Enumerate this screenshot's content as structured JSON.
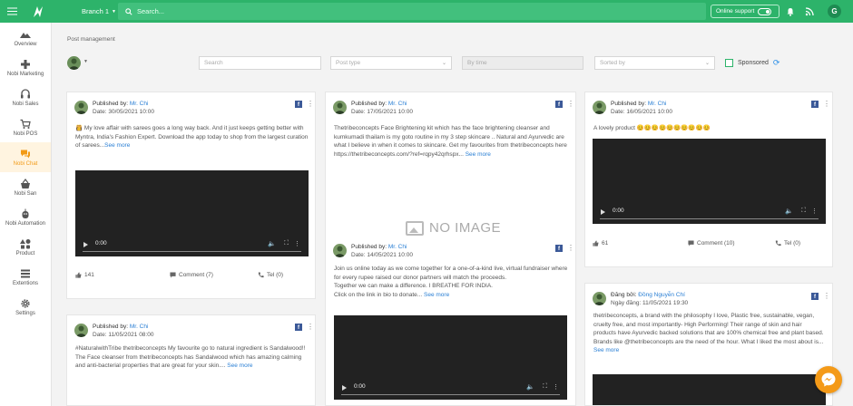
{
  "topbar": {
    "branch": "Branch 1",
    "search_placeholder": "Search...",
    "online_support": "Online support",
    "user_initial": "G"
  },
  "sidebar": {
    "items": [
      {
        "label": "Overview",
        "icon": "mountain-icon"
      },
      {
        "label": "Nobi Marketing",
        "icon": "gamepad-icon"
      },
      {
        "label": "Nobi Sales",
        "icon": "headset-icon"
      },
      {
        "label": "Nobi POS",
        "icon": "cart-icon"
      },
      {
        "label": "Nobi Chat",
        "icon": "chat-icon"
      },
      {
        "label": "Nobi San",
        "icon": "basket-icon"
      },
      {
        "label": "Nobi Automation",
        "icon": "robot-icon"
      },
      {
        "label": "Product",
        "icon": "shapes-icon"
      },
      {
        "label": "Extentions",
        "icon": "list-icon"
      },
      {
        "label": "Settings",
        "icon": "gear-icon"
      }
    ],
    "active_index": 4
  },
  "page": {
    "breadcrumb": "Post management"
  },
  "filters": {
    "search_placeholder": "Search",
    "post_type_placeholder": "Post type",
    "by_time_placeholder": "By time",
    "sorted_by_placeholder": "Sorted by",
    "sponsored_label": "Sponsored"
  },
  "posts": {
    "p1": {
      "published_label": "Published by:",
      "author": "Mr. Chi",
      "date": "Date: 30/05/2021  10:00",
      "text": "👸 My love affair with sarees goes a long way back. And it just keeps getting better with Myntra, India's Fashion Expert. Download the app today to shop from the largest curation of sarees...",
      "more": "See more",
      "video_time": "0:00",
      "likes": "141",
      "comments": "Comment (7)",
      "tel": "Tel (0)"
    },
    "p2": {
      "published_label": "Published by:",
      "author": "Mr. Chi",
      "date": "Date: 17/05/2021  10:00",
      "text": "Thetribeconcepts  Face Brightening kit which has the face brightening cleanser and kumkumadi thailam is my goto routine in my 3 step skincare .. Natural and Ayurvedic are what I believe in when it comes to skincare. Get my favourites from thetribeconcepts  here https://thetribeconcepts.com/?ref=rqpy42qrhspx...",
      "more": "See more",
      "no_image": "NO IMAGE"
    },
    "p3": {
      "published_label": "Published by:",
      "author": "Mr. Chi",
      "date": "Date: 16/05/2021  10:00",
      "text": "A lovely product 😊😊😊😊😊😊😊😊😊😊",
      "video_time": "0:00",
      "likes": "61",
      "comments": "Comment (10)",
      "tel": "Tel (0)"
    },
    "p4": {
      "published_label": "Published by:",
      "author": "Mr. Chi",
      "date": "Date: 11/05/2021  08:00",
      "text": "#NaturalwithTribe thetribeconcepts My favourite go to natural ingredient is Sandalwood!! The Face cleanser from thetribeconcepts has Sandalwood which has amazing calming and anti-bacterial properties that are great for your skin....",
      "more": "See more"
    },
    "p5": {
      "published_label": "Published by:",
      "author": "Mr. Chi",
      "date": "Date: 14/05/2021  10:00",
      "text1": "Join us online today as we come together for a one-of-a-kind live, virtual fundraiser where for every rupee raised our donor partners will match the proceeds.",
      "text2": "Together we can make a difference. I BREATHE FOR INDIA.",
      "text3": "Click on the link in bio to donate...",
      "more": "See more",
      "video_time": "0:00"
    },
    "p6": {
      "published_label": "Đăng bởi:",
      "author": "Đồng Nguyễn Chí",
      "date": "Ngày đăng:  11/05/2021  19:30",
      "text": "thetribeconcepts, a brand with the philosophy I love, Plastic free, sustainable, vegan, cruelty free, and most importantly- High Performing! Their range of skin and hair products have Ayurvedic backed solutions that are 100% chemical free and plant based. Brands like @thetribeconcepts are the need of the hour. What I liked the most about is...",
      "more": "See more"
    }
  },
  "colors": {
    "primary_green": "#2db36a",
    "accent_orange": "#f29a16",
    "link_blue": "#2a7fd4"
  }
}
